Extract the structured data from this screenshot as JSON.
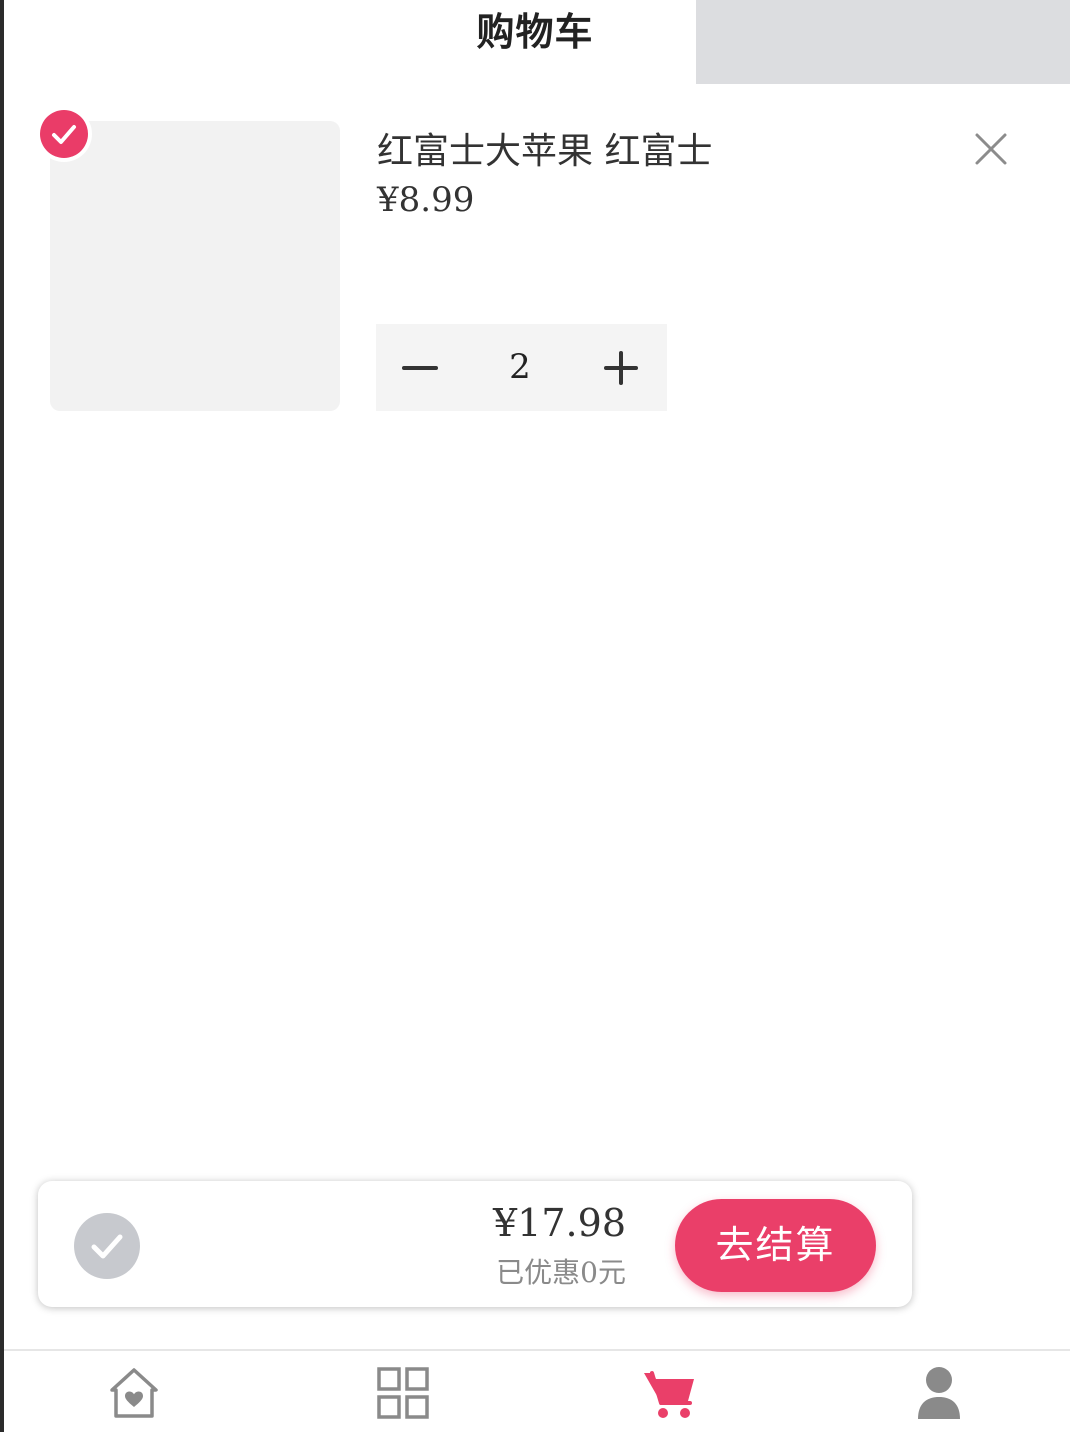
{
  "header": {
    "title": "购物车"
  },
  "cart": {
    "items": [
      {
        "name": "红富士大苹果 红富士",
        "price": "¥8.99",
        "quantity": "2",
        "selected": true
      }
    ]
  },
  "checkout": {
    "total": "¥17.98",
    "discount": "已优惠0元",
    "button_label": "去结算",
    "select_all": false
  },
  "tabbar": {
    "tabs": [
      {
        "icon": "home-icon",
        "active": false
      },
      {
        "icon": "category-grid-icon",
        "active": false
      },
      {
        "icon": "cart-icon",
        "active": true
      },
      {
        "icon": "user-icon",
        "active": false
      }
    ]
  },
  "colors": {
    "accent": "#ea3f69",
    "inactive_icon": "#8a8a8a",
    "unselected_check": "#c7c9ce"
  }
}
